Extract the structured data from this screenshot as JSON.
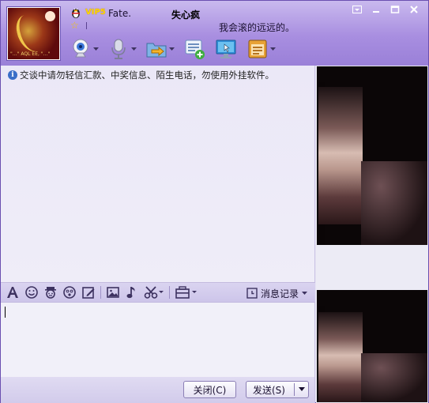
{
  "header": {
    "vip_badge": "VIP5",
    "nickname": "Fate.",
    "remark": "失心疯",
    "signature": "我会滚的远远的。",
    "avatar_caption": "\"…\" AQL EE, \"…\""
  },
  "window_controls": [
    {
      "name": "dropdown",
      "icon": "chevron-down-icon"
    },
    {
      "name": "minimize",
      "icon": "minimize-icon"
    },
    {
      "name": "maximize",
      "icon": "maximize-icon"
    },
    {
      "name": "close",
      "icon": "close-icon"
    }
  ],
  "toolbar": {
    "items": [
      {
        "name": "video",
        "icon": "webcam-icon",
        "has_dropdown": true
      },
      {
        "name": "voice",
        "icon": "microphone-icon",
        "has_dropdown": true
      },
      {
        "name": "file-transfer",
        "icon": "folder-send-icon",
        "has_dropdown": true
      },
      {
        "name": "group-chat",
        "icon": "create-group-icon",
        "has_dropdown": false
      },
      {
        "name": "remote-assist",
        "icon": "remote-desktop-icon",
        "has_dropdown": false
      },
      {
        "name": "app-box",
        "icon": "app-box-icon",
        "has_dropdown": true
      }
    ]
  },
  "chat": {
    "notice": "交谈中请勿轻信汇款、中奖信息、陌生电话，勿使用外挂软件。"
  },
  "format_bar": {
    "items": [
      "font-icon",
      "emoji-icon",
      "magic-face-icon",
      "shake-icon",
      "handwriting-icon",
      "image-icon",
      "music-icon",
      "screenshot-icon",
      "send-file-icon"
    ],
    "message_log_label": "消息记录"
  },
  "input": {
    "value": ""
  },
  "buttons": {
    "close_label": "关闭(C)",
    "send_label": "发送(S)"
  },
  "colors": {
    "header_top": "#c9b9ee",
    "header_bottom": "#9a80d8",
    "chat_bg": "#ebe8f7",
    "accent": "#6a4fb0",
    "vip_gold": "#ffd700"
  }
}
